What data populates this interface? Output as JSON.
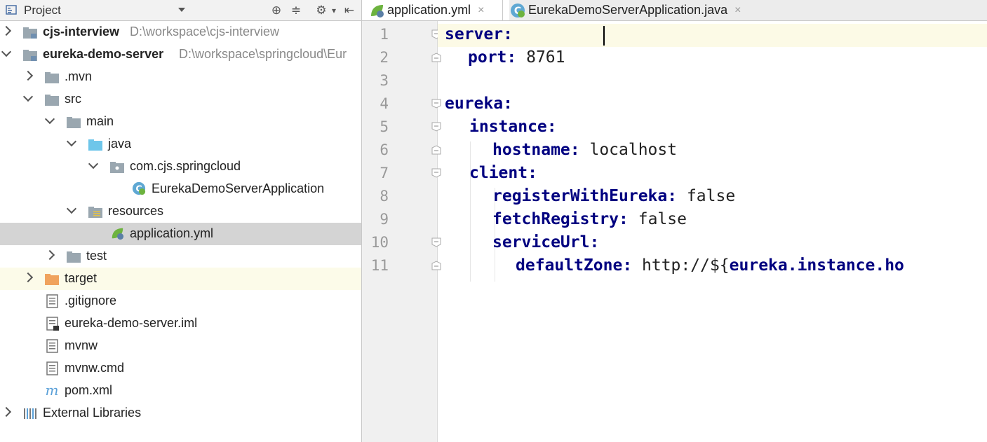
{
  "project_panel": {
    "title": "Project"
  },
  "tree": [
    {
      "label": "cjs-interview",
      "path": "D:\\workspace\\cjs-interview"
    },
    {
      "label": "eureka-demo-server",
      "path": "D:\\workspace\\springcloud\\Eur"
    },
    {
      "label": ".mvn"
    },
    {
      "label": "src"
    },
    {
      "label": "main"
    },
    {
      "label": "java"
    },
    {
      "label": "com.cjs.springcloud"
    },
    {
      "label": "EurekaDemoServerApplication"
    },
    {
      "label": "resources"
    },
    {
      "label": "application.yml"
    },
    {
      "label": "test"
    },
    {
      "label": "target"
    },
    {
      "label": ".gitignore"
    },
    {
      "label": "eureka-demo-server.iml"
    },
    {
      "label": "mvnw"
    },
    {
      "label": "mvnw.cmd"
    },
    {
      "label": "pom.xml"
    },
    {
      "label": "External Libraries"
    }
  ],
  "tabs": [
    {
      "label": "application.yml",
      "close": "×"
    },
    {
      "label": "EurekaDemoServerApplication.java",
      "close": "×"
    }
  ],
  "editor": {
    "line_numbers": [
      "1",
      "2",
      "3",
      "4",
      "5",
      "6",
      "7",
      "8",
      "9",
      "10",
      "11"
    ],
    "lines": [
      {
        "key": "server:",
        "value": ""
      },
      {
        "key": "port:",
        "value": " 8761"
      },
      {
        "key": "",
        "value": ""
      },
      {
        "key": "eureka:",
        "value": ""
      },
      {
        "key": "instance:",
        "value": ""
      },
      {
        "key": "hostname:",
        "value": " localhost"
      },
      {
        "key": "client:",
        "value": ""
      },
      {
        "key": "registerWithEureka:",
        "value": " false"
      },
      {
        "key": "fetchRegistry:",
        "value": " false"
      },
      {
        "key": "serviceUrl:",
        "value": ""
      },
      {
        "key": "defaultZone:",
        "value": " http://${",
        "key2": "eureka.instance.ho"
      }
    ]
  },
  "colors": {
    "yaml_key": "#000080",
    "selection": "#d4d4d4",
    "current_line": "#fcfae6"
  }
}
